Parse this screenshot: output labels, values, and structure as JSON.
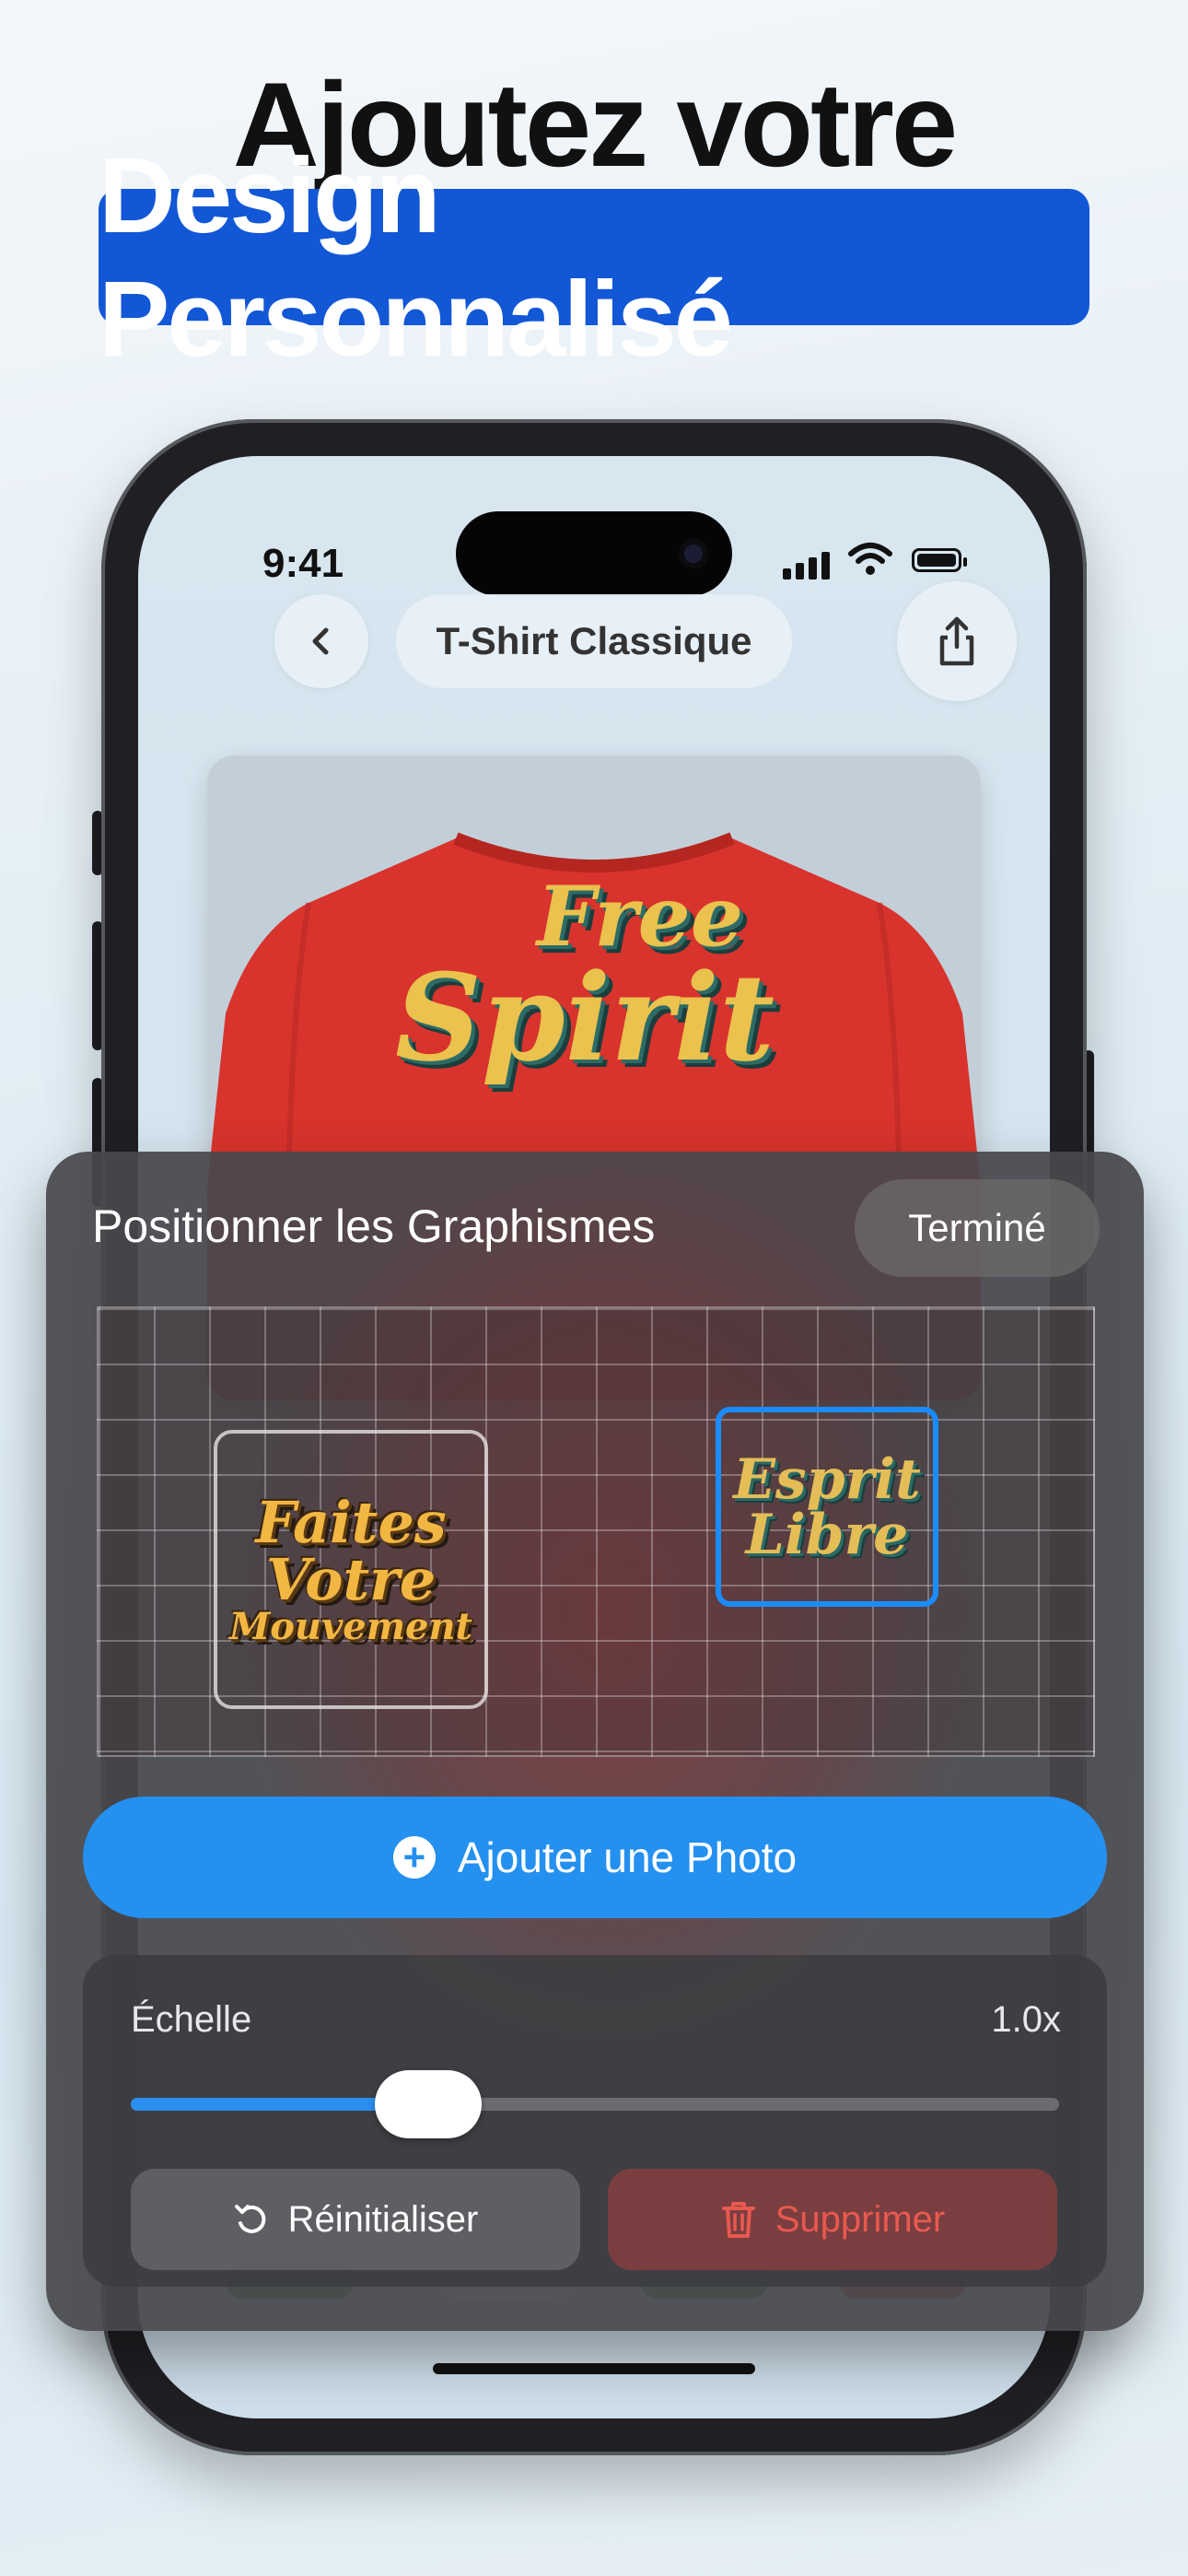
{
  "headline": {
    "line1": "Ajoutez votre",
    "line2": "Design Personnalisé"
  },
  "status_bar": {
    "time": "9:41"
  },
  "nav": {
    "back_icon": "chevron-left-icon",
    "title": "T-Shirt Classique",
    "share_icon": "share-icon"
  },
  "product": {
    "tshirt_color": "#d8332d",
    "print_line1": "Free",
    "print_line2": "Spirit"
  },
  "panel": {
    "title": "Positionner les Graphismes",
    "done_label": "Terminé",
    "stickers": [
      {
        "lines": [
          "Faites",
          "Votre",
          "Mouvement"
        ],
        "selected": false
      },
      {
        "lines": [
          "Esprit",
          "Libre"
        ],
        "selected": true
      }
    ],
    "add_photo_label": "Ajouter une Photo",
    "scale": {
      "label": "Échelle",
      "value_text": "1.0x",
      "slider_fraction": 0.32
    },
    "reset_label": "Réinitialiser",
    "delete_label": "Supprimer"
  },
  "colors": {
    "accent_blue": "#2490ef",
    "headline_highlight": "#1257d6",
    "danger_red": "#e9594f"
  }
}
